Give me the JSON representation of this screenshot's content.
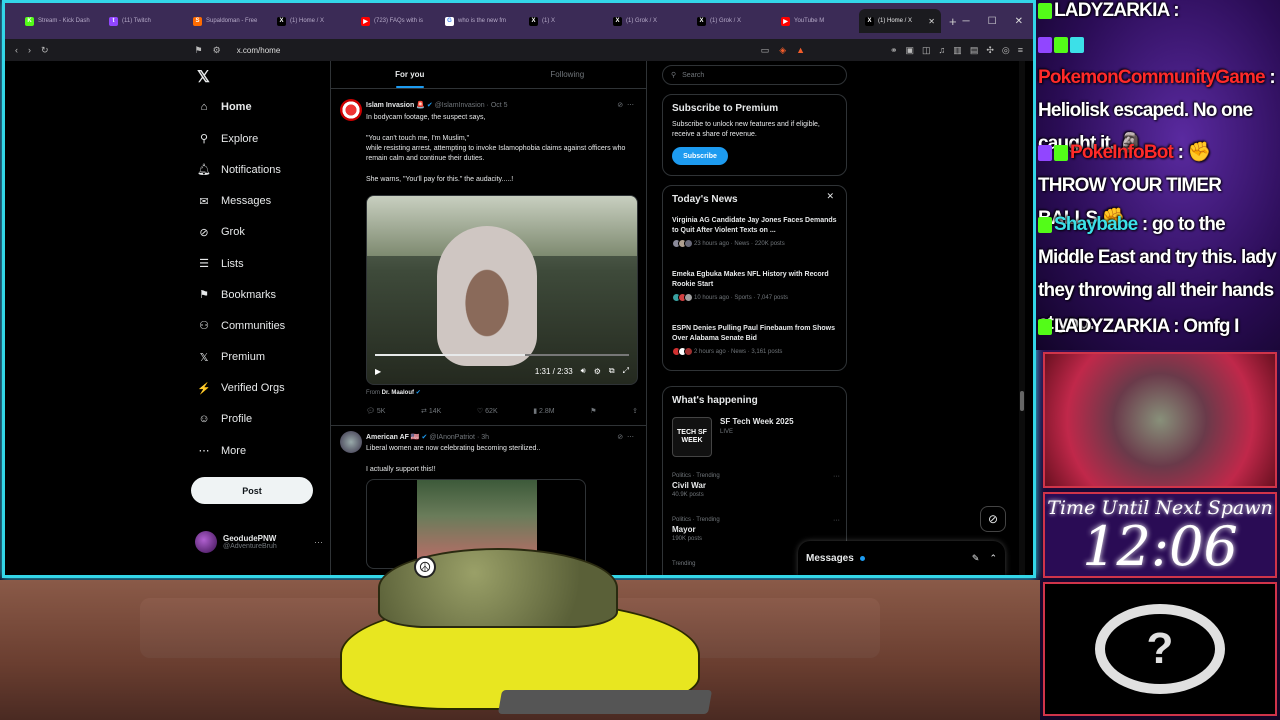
{
  "browser": {
    "tabs": [
      {
        "title": "Stream - Kick Dash",
        "color": "#53fc18",
        "glyph": "K",
        "active": false
      },
      {
        "title": "(11) Twitch",
        "color": "#9146ff",
        "glyph": "t",
        "active": false
      },
      {
        "title": "Supaldoman - Free",
        "color": "#ff6b00",
        "glyph": "S",
        "active": false
      },
      {
        "title": "(1) Home / X",
        "color": "#000000",
        "glyph": "X",
        "active": false
      },
      {
        "title": "(723) FAQs with is",
        "color": "#ff0000",
        "glyph": "▶",
        "active": false
      },
      {
        "title": "who is the new fm",
        "color": "#ffffff",
        "glyph": "G",
        "active": false
      },
      {
        "title": "(1) X",
        "color": "#000000",
        "glyph": "X",
        "active": false
      },
      {
        "title": "(1) Grok / X",
        "color": "#000000",
        "glyph": "X",
        "active": false
      },
      {
        "title": "(1) Grok / X",
        "color": "#000000",
        "glyph": "X",
        "active": false
      },
      {
        "title": "YouTube M",
        "color": "#ff0000",
        "glyph": "▶",
        "active": false
      },
      {
        "title": "(1) Home / X",
        "color": "#000000",
        "glyph": "X",
        "active": true
      }
    ],
    "url": "x.com/home"
  },
  "nav": {
    "items": [
      {
        "icon": "⌂",
        "icon_name": "home-icon",
        "label": "Home",
        "bold": true
      },
      {
        "icon": "⚲",
        "icon_name": "search-icon",
        "label": "Explore"
      },
      {
        "icon": "🔔︎",
        "icon_name": "bell-icon",
        "label": "Notifications"
      },
      {
        "icon": "✉",
        "icon_name": "mail-icon",
        "label": "Messages"
      },
      {
        "icon": "⊘",
        "icon_name": "grok-icon",
        "label": "Grok"
      },
      {
        "icon": "☰",
        "icon_name": "list-icon",
        "label": "Lists"
      },
      {
        "icon": "⚑",
        "icon_name": "bookmark-icon",
        "label": "Bookmarks"
      },
      {
        "icon": "⚇",
        "icon_name": "communities-icon",
        "label": "Communities"
      },
      {
        "icon": "𝕏",
        "icon_name": "premium-icon",
        "label": "Premium"
      },
      {
        "icon": "⚡",
        "icon_name": "verified-orgs-icon",
        "label": "Verified Orgs"
      },
      {
        "icon": "☺",
        "icon_name": "profile-icon",
        "label": "Profile"
      },
      {
        "icon": "⋯",
        "icon_name": "more-icon",
        "label": "More"
      }
    ],
    "post_label": "Post",
    "profile": {
      "name": "GeodudePNW",
      "handle": "@AdventureBruh"
    }
  },
  "feed": {
    "tabs": [
      "For you",
      "Following"
    ],
    "tweet1": {
      "name": "Islam Invasion",
      "flag": "🚨",
      "meta": "@IslamInvasion · Oct 5",
      "line1": "In bodycam footage, the suspect says,",
      "line2": "\"You can't touch me, I'm Muslim,\"",
      "line3": "while resisting arrest, attempting to invoke Islamophobia claims against officers who remain calm and continue their duties.",
      "line4": "She warns, \"You'll pay for this.\" the audacity.....!",
      "video_time": "1:31 / 2:33",
      "video_progress": 0.59,
      "from_label": "From",
      "from_name": "Dr. Maalouf",
      "replies": "5K",
      "reposts": "14K",
      "likes": "62K",
      "views": "2.8M"
    },
    "tweet2": {
      "name": "American AF 🇺🇸",
      "meta": "@IAnonPatriot · 3h",
      "line1": "Liberal women are now celebrating becoming sterilized..",
      "line2": "I actually support this!!"
    }
  },
  "right": {
    "search_placeholder": "Search",
    "premium": {
      "title": "Subscribe to Premium",
      "text": "Subscribe to unlock new features and if eligible, receive a share of revenue.",
      "button": "Subscribe"
    },
    "news": {
      "title": "Today's News",
      "items": [
        {
          "headline": "Virginia AG Candidate Jay Jones Faces Demands to Quit After Violent Texts on ...",
          "meta": "23 hours ago · News · 220K posts"
        },
        {
          "headline": "Emeka Egbuka Makes NFL History with Record Rookie Start",
          "meta": "10 hours ago · Sports · 7,047 posts"
        },
        {
          "headline": "ESPN Denies Pulling Paul Finebaum from Shows Over Alabama Senate Bid",
          "meta": "2 hours ago · News · 3,161 posts"
        }
      ]
    },
    "happening": {
      "title": "What's happening",
      "event_logo": "TECH SF WEEK",
      "event_title": "SF Tech Week 2025",
      "event_status": "LIVE",
      "trends": [
        {
          "category": "Politics · Trending",
          "name": "Civil War",
          "count": "40.9K posts"
        },
        {
          "category": "Politics · Trending",
          "name": "Mayor",
          "count": "190K posts"
        },
        {
          "category": "Trending",
          "name": "",
          "count": ""
        }
      ]
    },
    "messages_label": "Messages"
  },
  "chat": {
    "lines": [
      {
        "user": "LADYZARKIA",
        "user_color": "#ffffff",
        "text": ":"
      },
      {
        "user": "PokemonCommunityGame",
        "user_color": "#ff2a2a",
        "text": ": Heliolisk escaped. No one caught it. 🗿"
      },
      {
        "user": "PokeInfoBot",
        "user_color": "#ff2a2a",
        "text": ": ✊ THROW YOUR TIMER BALLS ✊"
      },
      {
        "user": "Shaybabe",
        "user_color": "#3ce0e8",
        "text": ": go to the Middle East and try this. lady they throwing all their hands at you."
      },
      {
        "user": "LADYZARKIA",
        "user_color": "#ffffff",
        "text": ": Omfg I cant"
      }
    ]
  },
  "widgets": {
    "timer_label": "Time Until Next Spawn",
    "timer_value": "12:06",
    "logo_glyph": "?"
  }
}
